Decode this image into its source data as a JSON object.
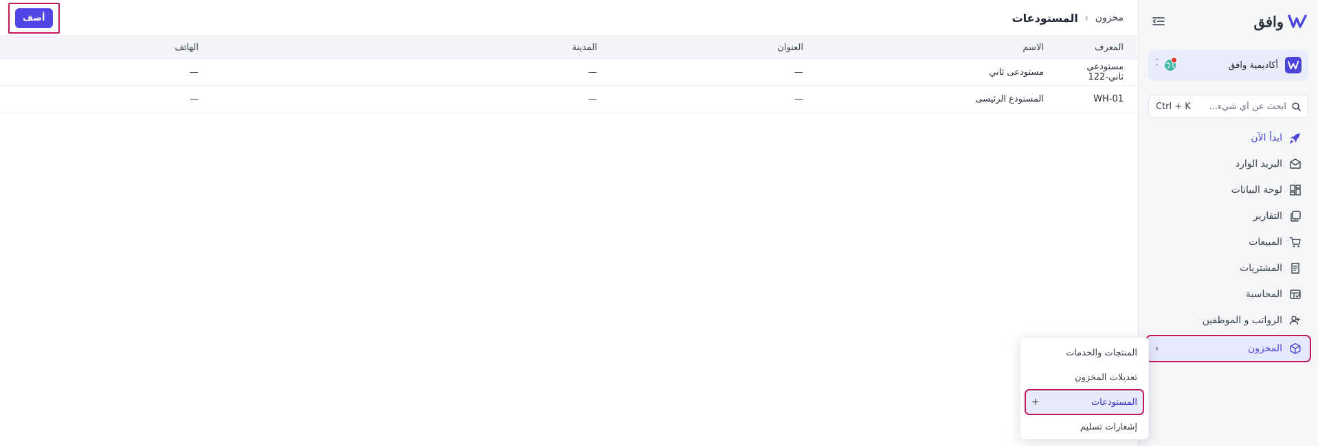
{
  "app": {
    "brand_name": "وافق",
    "colors": {
      "accent": "#4a45d8",
      "button": "#5046e5",
      "highlight": "#c2185b",
      "sidebar_bg": "#f5f6f8"
    }
  },
  "sidebar": {
    "org": {
      "name": "أكاديمية وافق",
      "logo_icon": "w-logo-icon"
    },
    "search": {
      "placeholder": "ابحث عن أي شيء...",
      "shortcut": "Ctrl + K"
    },
    "items": [
      {
        "label": "ابدأ الآن",
        "icon": "rocket-icon"
      },
      {
        "label": "البريد الوارد",
        "icon": "inbox-icon"
      },
      {
        "label": "لوحة البيانات",
        "icon": "dashboard-icon"
      },
      {
        "label": "التقارير",
        "icon": "reports-icon"
      },
      {
        "label": "المبيعات",
        "icon": "cart-icon"
      },
      {
        "label": "المشتريات",
        "icon": "receipt-icon"
      },
      {
        "label": "المحاسبة",
        "icon": "accounting-icon"
      },
      {
        "label": "الرواتب و الموظفين",
        "icon": "users-icon"
      },
      {
        "label": "المخزون",
        "icon": "box-icon",
        "active": true
      }
    ]
  },
  "submenu": {
    "items": [
      {
        "label": "المنتجات والخدمات"
      },
      {
        "label": "تعديلات المخزون"
      },
      {
        "label": "المستودعات",
        "active": true,
        "action": "+"
      },
      {
        "label": "إشعارات تسليم"
      }
    ]
  },
  "header": {
    "breadcrumb_parent": "مخزون",
    "breadcrumb_sep": "›",
    "title": "المستودعات",
    "add_label": "أضف"
  },
  "table": {
    "columns": [
      "المعرف",
      "الاسم",
      "العنوان",
      "المدينة",
      "الهاتف"
    ],
    "rows": [
      [
        "مستودعي ثاني-122",
        "مستودعى ثاني",
        "—",
        "—",
        "—"
      ],
      [
        "WH-01",
        "المستودع الرئيسى",
        "—",
        "—",
        "—"
      ]
    ]
  }
}
